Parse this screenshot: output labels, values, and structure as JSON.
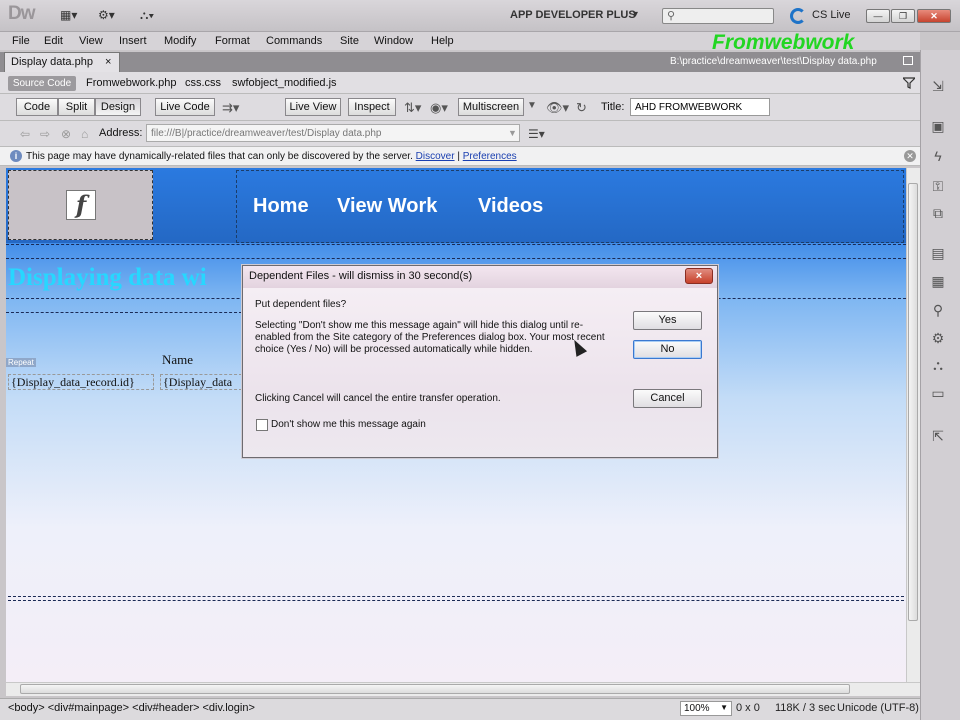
{
  "app": {
    "logo": "Dw",
    "workspace": "APP DEVELOPER PLUS",
    "search_placeholder": "",
    "cs_live": "CS Live",
    "watermark": "Fromwebwork"
  },
  "menu": [
    "File",
    "Edit",
    "View",
    "Insert",
    "Modify",
    "Format",
    "Commands",
    "Site",
    "Window",
    "Help"
  ],
  "document": {
    "tab_label": "Display data.php",
    "tab_close": "×",
    "path": "B:\\practice\\dreamweaver\\test\\Display data.php",
    "source_code": "Source Code",
    "related_files": [
      "Fromwebwork.php",
      "css.css",
      "swfobject_modified.js"
    ]
  },
  "toolbar": {
    "code": "Code",
    "split": "Split",
    "design": "Design",
    "live_code": "Live Code",
    "live_view": "Live View",
    "inspect": "Inspect",
    "multiscreen": "Multiscreen",
    "title_label": "Title:",
    "title_value": "AHD FROMWEBWORK"
  },
  "browser_nav": {
    "address_label": "Address:",
    "address_value": "file:///B|/practice/dreamweaver/test/Display data.php"
  },
  "infobar": {
    "message": "This page may have dynamically-related files that can only be discovered by the server.",
    "discover": "Discover",
    "separator": "|",
    "preferences": "Preferences"
  },
  "page": {
    "nav_links": [
      "Home",
      "View Work",
      "Videos"
    ],
    "heading": "Displaying data wi",
    "repeat_tag": "Repeat",
    "column_name": "Name",
    "cell_id": "{Display_data_record.id}",
    "cell_name": "{Display_data"
  },
  "dialog": {
    "title": "Dependent Files - will dismiss in 30 second(s)",
    "close": "×",
    "question": "Put dependent files?",
    "message": "Selecting \"Don't show me this message again\" will hide this dialog until re-enabled from the Site category of the Preferences dialog box. Your most recent choice (Yes / No) will be processed automatically while hidden.",
    "cancel_note": "Clicking Cancel will cancel the entire transfer operation.",
    "checkbox_label": "Don't show me this message again",
    "yes": "Yes",
    "no": "No",
    "cancel": "Cancel"
  },
  "statusbar": {
    "tags": "<body> <div#mainpage> <div#header> <div.login>",
    "zoom": "100%",
    "dimensions": "0 x 0",
    "size_time": "118K / 3 sec",
    "encoding": "Unicode (UTF-8)"
  }
}
